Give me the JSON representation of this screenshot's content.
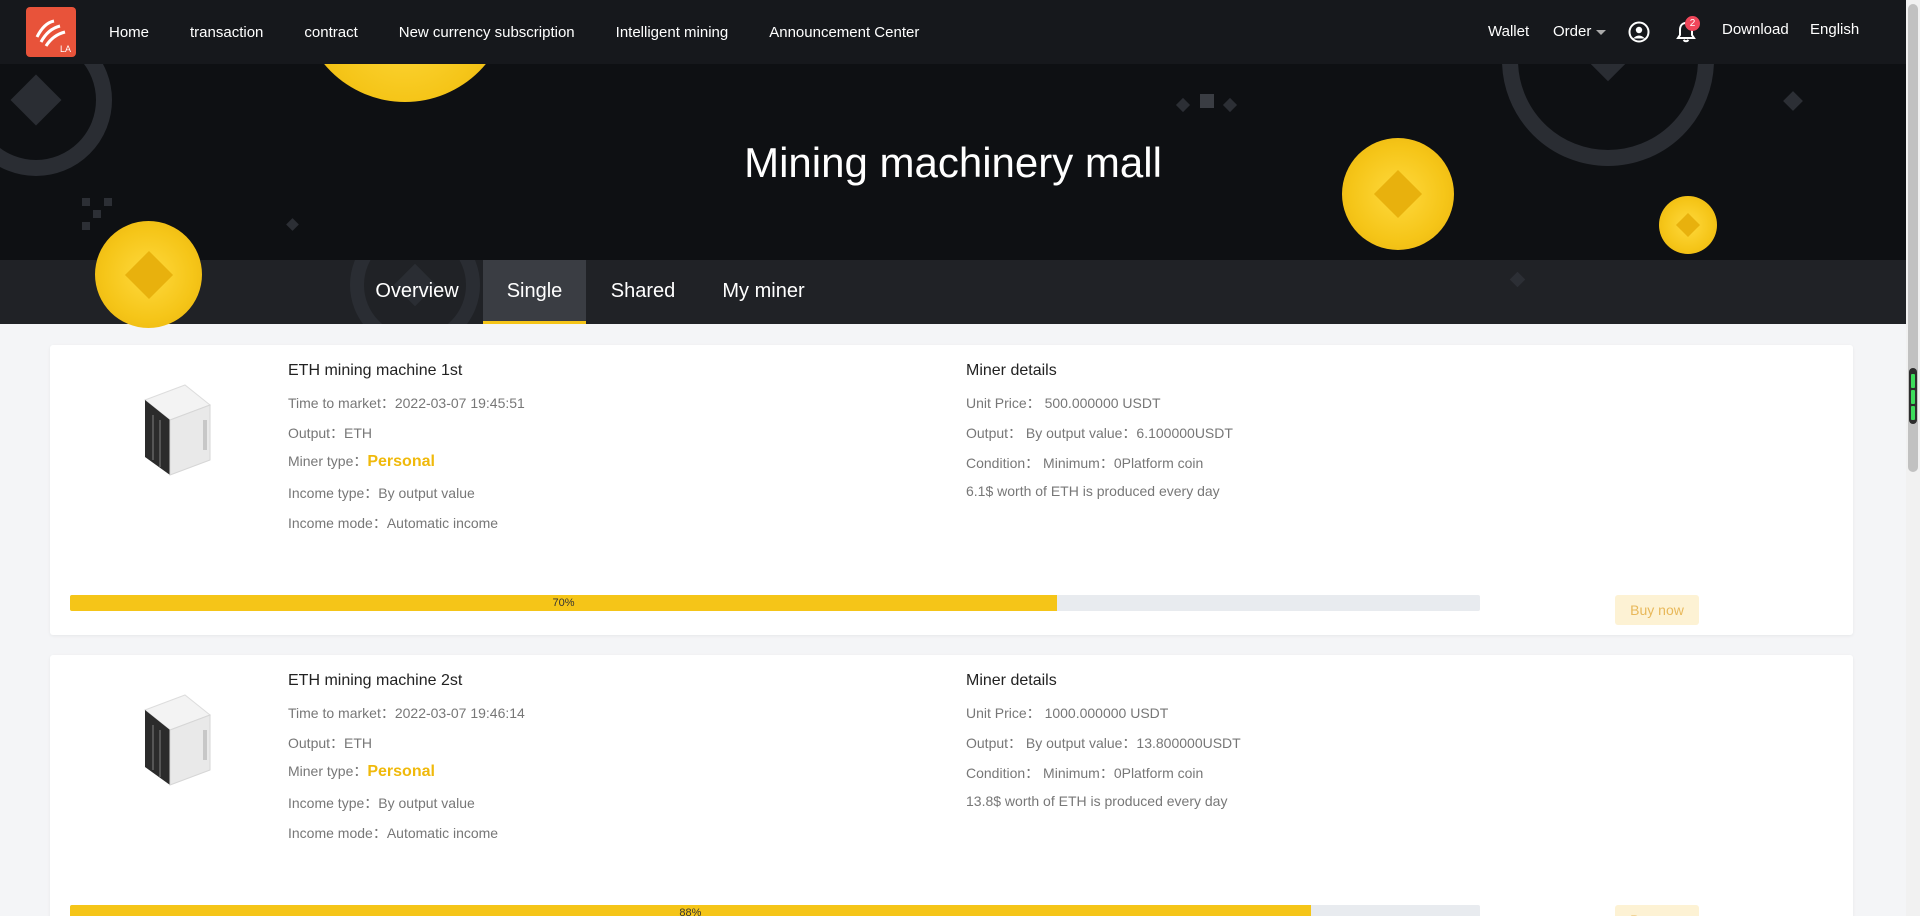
{
  "nav": {
    "logo_text": "LA",
    "links": [
      "Home",
      "transaction",
      "contract",
      "New currency subscription",
      "Intelligent mining",
      "Announcement Center"
    ],
    "wallet": "Wallet",
    "order": "Order",
    "notification_count": "2",
    "download": "Download",
    "language": "English"
  },
  "banner": {
    "title": "Mining machinery mall"
  },
  "tabs": [
    {
      "label": "Overview",
      "active": false
    },
    {
      "label": "Single",
      "active": true
    },
    {
      "label": "Shared",
      "active": false
    },
    {
      "label": "My miner",
      "active": false
    }
  ],
  "miners": [
    {
      "title": "ETH mining machine 1st",
      "time_label": "Time to market：",
      "time_value": "2022-03-07 19:45:51",
      "output_label": "Output：",
      "output_value": "ETH",
      "miner_type_label": "Miner type：",
      "miner_type_value": "Personal",
      "income_type_label": "Income type：",
      "income_type_value": "By output value",
      "income_mode_label": "Income mode：",
      "income_mode_value": "Automatic income",
      "details_title": "Miner details",
      "unit_price_label": "Unit Price：",
      "unit_price_value": "500.000000 USDT",
      "detail_output_label": "Output：",
      "detail_output_value": "By output value：6.100000USDT",
      "condition_label": "Condition：",
      "condition_value": "Minimum：0Platform coin",
      "daily_note": "6.1$ worth of ETH is produced every day",
      "progress": 70,
      "progress_label": "70%",
      "buy_label": "Buy now"
    },
    {
      "title": "ETH mining machine 2st",
      "time_label": "Time to market：",
      "time_value": "2022-03-07 19:46:14",
      "output_label": "Output：",
      "output_value": "ETH",
      "miner_type_label": "Miner type：",
      "miner_type_value": "Personal",
      "income_type_label": "Income type：",
      "income_type_value": "By output value",
      "income_mode_label": "Income mode：",
      "income_mode_value": "Automatic income",
      "details_title": "Miner details",
      "unit_price_label": "Unit Price：",
      "unit_price_value": "1000.000000 USDT",
      "detail_output_label": "Output：",
      "detail_output_value": "By output value：13.800000USDT",
      "condition_label": "Condition：",
      "condition_value": "Minimum：0Platform coin",
      "daily_note": "13.8$ worth of ETH is produced every day",
      "progress": 88,
      "progress_label": "88%",
      "buy_label": "Buy now"
    }
  ]
}
